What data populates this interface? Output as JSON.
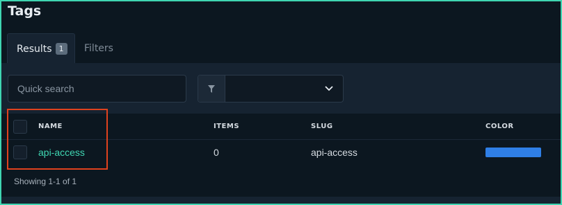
{
  "page": {
    "title": "Tags"
  },
  "tabs": [
    {
      "label": "Results",
      "badge": "1",
      "active": true
    },
    {
      "label": "Filters",
      "active": false
    }
  ],
  "toolbar": {
    "search_placeholder": "Quick search",
    "filter_value": ""
  },
  "table": {
    "columns": [
      "NAME",
      "ITEMS",
      "SLUG",
      "COLOR"
    ],
    "rows": [
      {
        "name": "api-access",
        "items": "0",
        "slug": "api-access",
        "color": "#2f7fe6",
        "selected": false
      }
    ],
    "footer": "Showing 1-1 of 1"
  },
  "colors": {
    "accent": "#3fd6b2",
    "highlight": "#e0421e"
  },
  "icons": {
    "filter": "filter-funnel-icon",
    "dropdown": "chevron-down-icon"
  }
}
